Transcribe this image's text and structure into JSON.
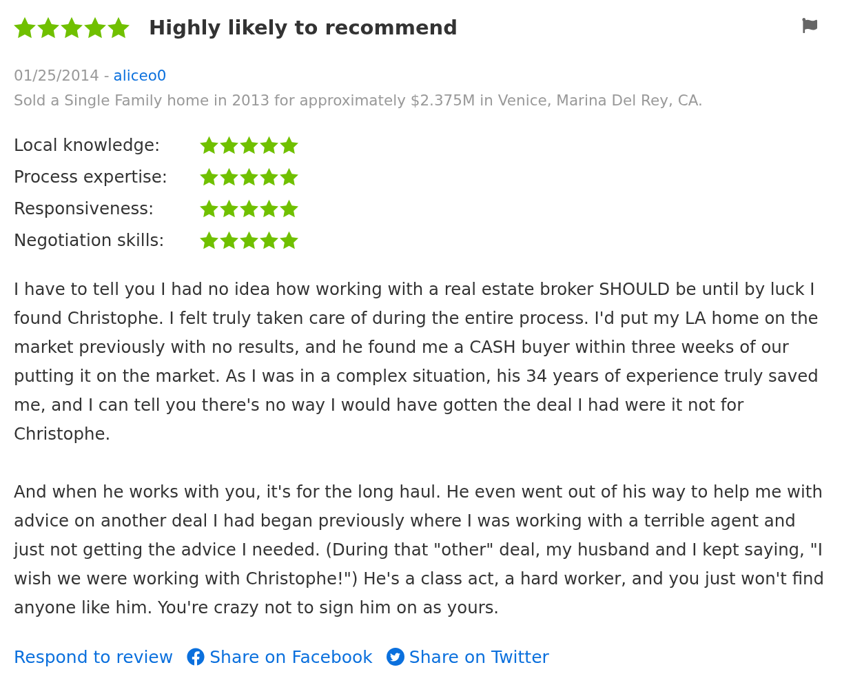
{
  "review": {
    "stars": 5,
    "headline": "Highly likely to recommend"
  },
  "meta": {
    "date": "01/25/2014 -",
    "author": "aliceo0",
    "transaction": "Sold a Single Family home in 2013 for approximately $2.375M in Venice, Marina Del Rey, CA."
  },
  "ratings": [
    {
      "label": "Local knowledge:",
      "stars": 5
    },
    {
      "label": "Process expertise:",
      "stars": 5
    },
    {
      "label": "Responsiveness:",
      "stars": 5
    },
    {
      "label": "Negotiation skills:",
      "stars": 5
    }
  ],
  "body": [
    "I have to tell you I had no idea how working with a real estate broker SHOULD be until by luck I found Christophe. I felt truly taken care of during the entire process. I'd put my LA home on the market previously with no results, and he found me a CASH buyer within three weeks of our putting it on the market. As I was in a complex situation, his 34 years of experience truly saved me, and I can tell you there's no way I would have gotten the deal I had were it not for Christophe.",
    "And when he works with you, it's for the long haul. He even went out of his way to help me with advice on another deal I had began previously where I was working with a terrible agent and just not getting the advice I needed. (During that \"other\" deal, my husband and I kept saying, \"I wish we were working with Christophe!\") He's a class act, a hard worker, and you just won't find anyone like him. You're crazy not to sign him on as yours."
  ],
  "actions": [
    {
      "kind": "respond",
      "label": "Respond to review"
    },
    {
      "kind": "facebook",
      "label": "Share on Facebook"
    },
    {
      "kind": "twitter",
      "label": "Share on Twitter"
    }
  ]
}
